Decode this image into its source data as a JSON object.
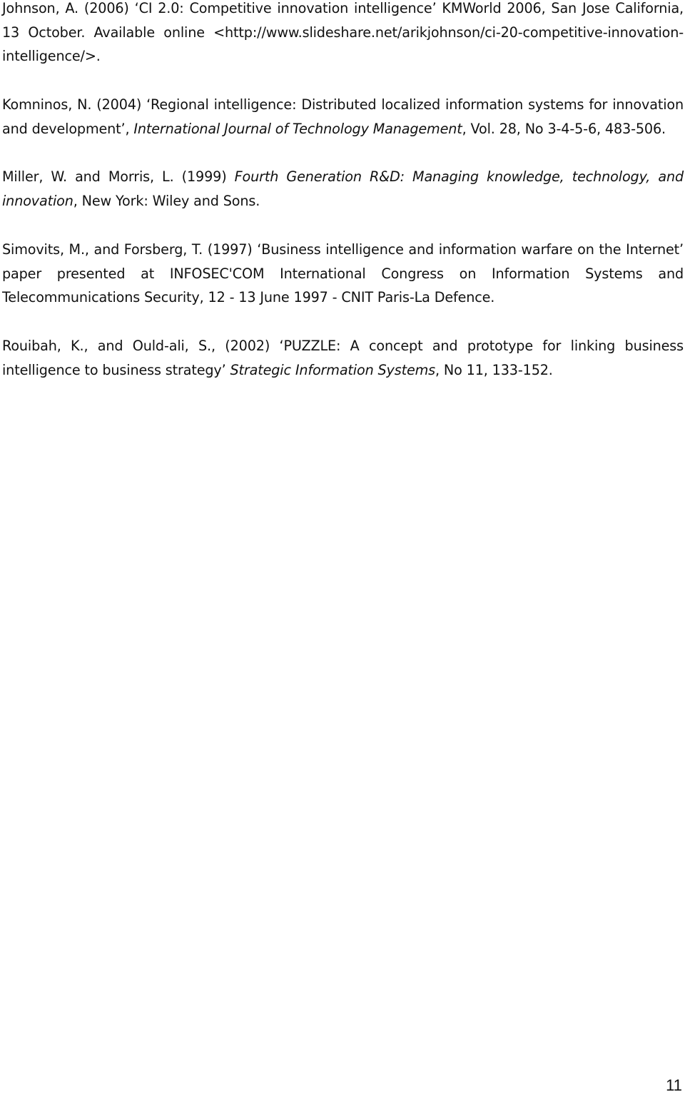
{
  "document": {
    "references": [
      {
        "id": "johnson",
        "parts": [
          {
            "text": "Johnson, A. (2006) ‘CI 2.0: Competitive innovation intelligence’ KMWorld 2006, San Jose California, 13 October. Available online <http://www.slideshare.net/arikjohnson/ci-20-competitive-innovation-intelligence/>.",
            "italic": false
          }
        ]
      },
      {
        "id": "komninos",
        "parts": [
          {
            "text": "Komninos, N. (2004) ‘Regional intelligence: Distributed localized information systems for innovation and development’, ",
            "italic": false
          },
          {
            "text": "International Journal of Technology Management",
            "italic": true
          },
          {
            "text": ", Vol. 28, No 3-4-5-6, 483-506.",
            "italic": false
          }
        ]
      },
      {
        "id": "miller",
        "parts": [
          {
            "text": "Miller, W. and Morris, L. (1999) ",
            "italic": false
          },
          {
            "text": "Fourth Generation R&D: Managing knowledge, technology, and innovation",
            "italic": true
          },
          {
            "text": ", New York: Wiley and Sons.",
            "italic": false
          }
        ]
      },
      {
        "id": "simovits",
        "parts": [
          {
            "text": "Simovits, M., and Forsberg, T. (1997) ‘Business intelligence and information warfare on the Internet’ paper presented at INFOSEC'COM International Congress on Information Systems and Telecommunications Security, 12 - 13 June 1997 - CNIT Paris-La Defence.",
            "italic": false
          }
        ]
      },
      {
        "id": "rouibah",
        "parts": [
          {
            "text": "Rouibah, K., and Ould-ali, S., (2002) ‘PUZZLE: A concept and prototype for linking business intelligence to business strategy’ ",
            "italic": false
          },
          {
            "text": "Strategic Information Systems",
            "italic": true
          },
          {
            "text": ", No 11, 133-152.",
            "italic": false
          }
        ]
      }
    ],
    "page_number": "11"
  }
}
